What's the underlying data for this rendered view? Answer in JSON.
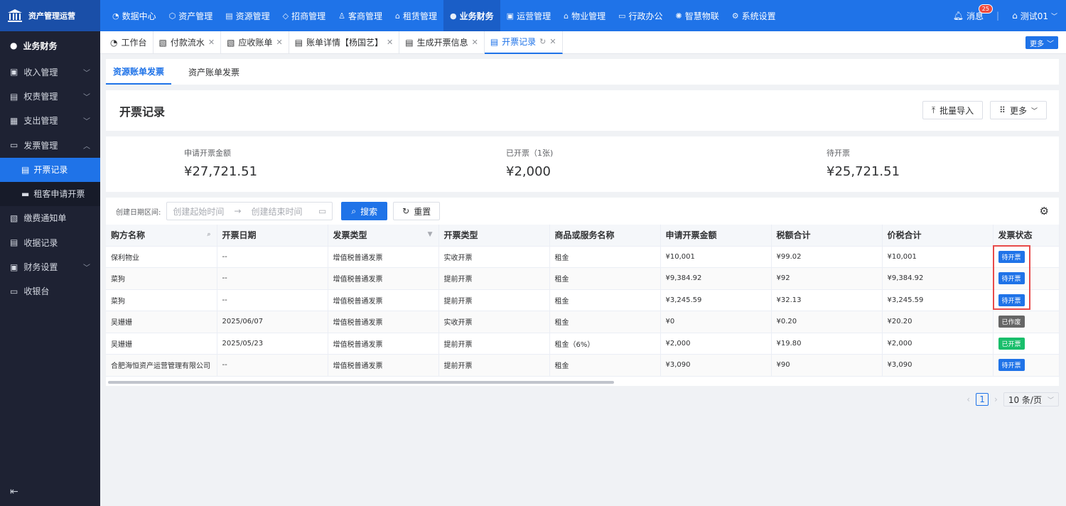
{
  "app": {
    "brand": "资产管理运营"
  },
  "nav": [
    {
      "label": "数据中心",
      "icon": "◔",
      "name": "dashboard-icon"
    },
    {
      "label": "资产管理",
      "icon": "⬡",
      "name": "cube-icon"
    },
    {
      "label": "资源管理",
      "icon": "▤",
      "name": "building-icon"
    },
    {
      "label": "招商管理",
      "icon": "◇",
      "name": "diamond-icon"
    },
    {
      "label": "客商管理",
      "icon": "♙",
      "name": "people-icon"
    },
    {
      "label": "租赁管理",
      "icon": "⌂",
      "name": "house-icon"
    },
    {
      "label": "业务财务",
      "icon": "●",
      "name": "finance-icon"
    },
    {
      "label": "运营管理",
      "icon": "▣",
      "name": "ops-icon"
    },
    {
      "label": "物业管理",
      "icon": "⌂",
      "name": "property-icon"
    },
    {
      "label": "行政办公",
      "icon": "▭",
      "name": "monitor-icon"
    },
    {
      "label": "智慧物联",
      "icon": "✺",
      "name": "iot-icon"
    },
    {
      "label": "系统设置",
      "icon": "⚙",
      "name": "settings-icon"
    }
  ],
  "top_right": {
    "messages_label": "消息",
    "message_count": "25",
    "user": "测试01"
  },
  "sidebar": {
    "section": "业务财务",
    "items": [
      {
        "label": "收入管理",
        "icon": "▣",
        "chev": "﹀"
      },
      {
        "label": "权责管理",
        "icon": "▤",
        "chev": "﹀"
      },
      {
        "label": "支出管理",
        "icon": "▦",
        "chev": "﹀"
      },
      {
        "label": "发票管理",
        "icon": "▭",
        "chev": "︿"
      }
    ],
    "subitems": [
      {
        "label": "开票记录",
        "icon": "▤",
        "active": true
      },
      {
        "label": "租客申请开票",
        "icon": "▬",
        "active": false
      }
    ],
    "items_after": [
      {
        "label": "缴费通知单",
        "icon": "▧",
        "chev": ""
      },
      {
        "label": "收据记录",
        "icon": "▤",
        "chev": ""
      },
      {
        "label": "财务设置",
        "icon": "▣",
        "chev": "﹀"
      },
      {
        "label": "收银台",
        "icon": "▭",
        "chev": ""
      }
    ],
    "collapse_icon": "⇤"
  },
  "tabs": [
    {
      "label": "工作台",
      "icon": "◔",
      "closable": false
    },
    {
      "label": "付款流水",
      "icon": "▧",
      "closable": true
    },
    {
      "label": "应收账单",
      "icon": "▧",
      "closable": true
    },
    {
      "label": "账单详情【杨国艺】",
      "icon": "▤",
      "closable": true
    },
    {
      "label": "生成开票信息",
      "icon": "▤",
      "closable": true
    },
    {
      "label": "开票记录",
      "icon": "▤",
      "closable": true,
      "active": true
    }
  ],
  "tabs_more": "更多",
  "subtabs": [
    "资源账单发票",
    "资产账单发票"
  ],
  "page": {
    "title": "开票记录",
    "import_btn": "批量导入",
    "more_btn": "更多"
  },
  "stats": [
    {
      "label": "申请开票金额",
      "value": "¥27,721.51"
    },
    {
      "label": "已开票（1张)",
      "value": "¥2,000"
    },
    {
      "label": "待开票",
      "value": "¥25,721.51"
    }
  ],
  "filter": {
    "label": "创建日期区间:",
    "start_placeholder": "创建起始时间",
    "end_placeholder": "创建结束时间",
    "search_btn": "搜索",
    "reset_btn": "重置"
  },
  "table": {
    "columns": [
      "购方名称",
      "开票日期",
      "发票类型",
      "开票类型",
      "商品或服务名称",
      "申请开票金额",
      "税额合计",
      "价税合计",
      "发票状态"
    ],
    "rows": [
      [
        "保利物业",
        "--",
        "增值税普通发票",
        "实收开票",
        "租金",
        "¥10,001",
        "¥99.02",
        "¥10,001",
        "待开票"
      ],
      [
        "菜狗",
        "--",
        "增值税普通发票",
        "提前开票",
        "租金",
        "¥9,384.92",
        "¥92",
        "¥9,384.92",
        "待开票"
      ],
      [
        "菜狗",
        "--",
        "增值税普通发票",
        "提前开票",
        "租金",
        "¥3,245.59",
        "¥32.13",
        "¥3,245.59",
        "待开票"
      ],
      [
        "吴姗姗",
        "2025/06/07",
        "增值税普通发票",
        "实收开票",
        "租金",
        "¥0",
        "¥0.20",
        "¥20.20",
        "已作废"
      ],
      [
        "吴姗姗",
        "2025/05/23",
        "增值税普通发票",
        "提前开票",
        "租金（6%）",
        "¥2,000",
        "¥19.80",
        "¥2,000",
        "已开票"
      ],
      [
        "合肥海恒资产运营管理有限公司",
        "--",
        "增值税普通发票",
        "提前开票",
        "租金",
        "¥3,090",
        "¥90",
        "¥3,090",
        "待开票"
      ]
    ]
  },
  "pager": {
    "current": "1",
    "size": "10 条/页"
  },
  "colors": {
    "primary": "#1f73e8",
    "sidebar": "#1e2233",
    "success": "#19be6b",
    "void": "#666666"
  }
}
